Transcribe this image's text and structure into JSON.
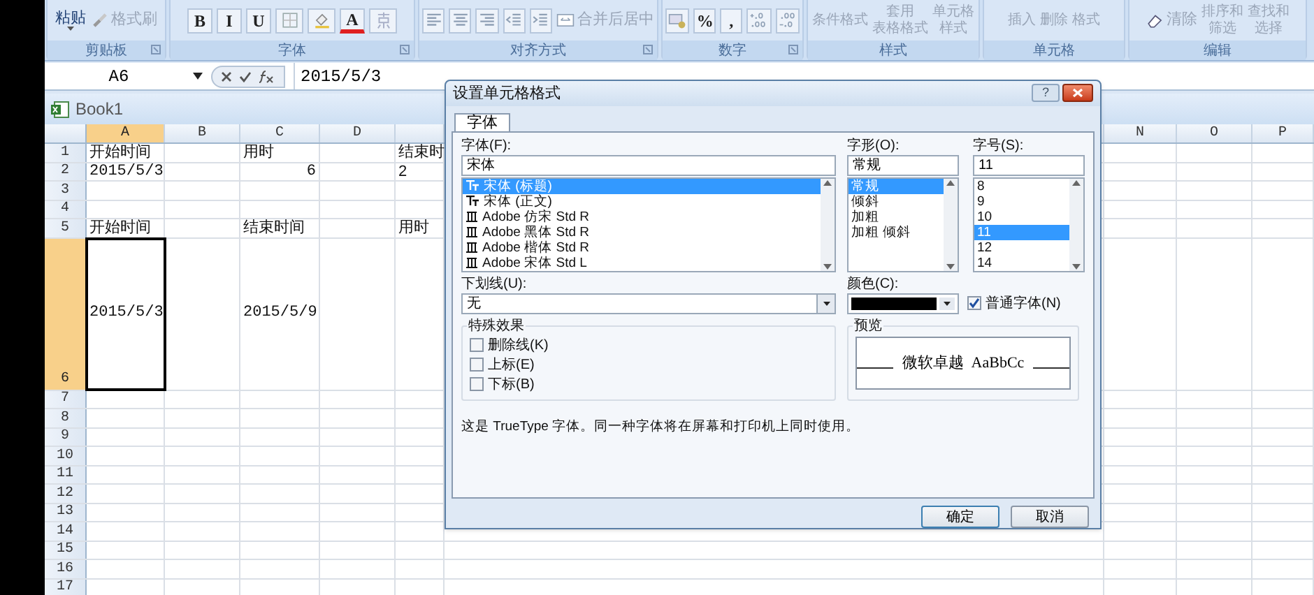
{
  "ribbon": {
    "groups": [
      {
        "label": "剪贴板",
        "items": [
          {
            "kind": "big",
            "text": "粘贴"
          },
          {
            "kind": "small",
            "text": "格式刷"
          }
        ]
      },
      {
        "label": "字体",
        "items": [
          {
            "kind": "letter",
            "text": "B"
          },
          {
            "kind": "letter",
            "text": "I"
          },
          {
            "kind": "letter",
            "text": "U"
          },
          {
            "kind": "icon"
          },
          {
            "kind": "icon"
          },
          {
            "kind": "letter",
            "text": "A"
          },
          {
            "kind": "icon"
          }
        ]
      },
      {
        "label": "对齐方式",
        "items": [
          {
            "kind": "icon"
          },
          {
            "kind": "icon"
          },
          {
            "kind": "icon"
          },
          {
            "kind": "icon"
          },
          {
            "kind": "icon"
          },
          {
            "kind": "small",
            "text": "合并后居中"
          }
        ]
      },
      {
        "label": "数字",
        "items": [
          {
            "kind": "icon"
          },
          {
            "kind": "letter",
            "text": "%"
          },
          {
            "kind": "letter",
            "text": ","
          },
          {
            "kind": "icon"
          },
          {
            "kind": "icon"
          }
        ]
      },
      {
        "label": "样式",
        "items": [
          {
            "kind": "stack",
            "text": "条件格式"
          },
          {
            "kind": "stack",
            "text": "套用",
            "text2": "表格格式"
          },
          {
            "kind": "stack",
            "text": "单元格",
            "text2": "样式"
          }
        ]
      },
      {
        "label": "单元格",
        "items": [
          {
            "kind": "stack",
            "text": "插入"
          },
          {
            "kind": "stack",
            "text": "删除"
          },
          {
            "kind": "stack",
            "text": "格式"
          }
        ]
      },
      {
        "label": "编辑",
        "items": [
          {
            "kind": "small",
            "text": "清除"
          },
          {
            "kind": "stack",
            "text": "排序和",
            "text2": "筛选"
          },
          {
            "kind": "stack",
            "text": "查找和",
            "text2": "选择"
          }
        ]
      }
    ]
  },
  "formula_bar": {
    "name_box": "A6",
    "value": "2015/5/3"
  },
  "workbook": {
    "title": "Book1"
  },
  "columns": [
    {
      "label": "A",
      "selected": true
    },
    {
      "label": "B",
      "selected": false
    },
    {
      "label": "C",
      "selected": false
    },
    {
      "label": "D",
      "selected": false
    },
    {
      "label": "N",
      "selected": false
    },
    {
      "label": "O",
      "selected": false
    },
    {
      "label": "P",
      "selected": false
    }
  ],
  "rows": [
    {
      "label": "1",
      "selected": false,
      "cells": [
        {
          "text": "开始时间",
          "kind": "text"
        },
        null,
        {
          "text": "用时",
          "kind": "text"
        },
        null,
        {
          "text": "结束时",
          "kind": "text"
        }
      ]
    },
    {
      "label": "2",
      "selected": false,
      "cells": [
        {
          "text": "2015/5/3",
          "kind": "number"
        },
        null,
        {
          "text": "6",
          "kind": "number"
        },
        null,
        {
          "text": "2",
          "kind": "text"
        }
      ]
    },
    {
      "label": "3",
      "selected": false,
      "cells": []
    },
    {
      "label": "4",
      "selected": false,
      "cells": []
    },
    {
      "label": "5",
      "selected": false,
      "cells": [
        {
          "text": "开始时间",
          "kind": "text"
        },
        null,
        {
          "text": "结束时间",
          "kind": "text"
        },
        null,
        {
          "text": "用时",
          "kind": "text"
        }
      ]
    },
    {
      "label": "6",
      "selected": true,
      "cells": [
        {
          "text": "2015/5/3",
          "kind": "number"
        },
        null,
        {
          "text": "2015/5/9",
          "kind": "number"
        }
      ]
    },
    {
      "label": "7",
      "selected": false,
      "cells": []
    },
    {
      "label": "8",
      "selected": false,
      "cells": []
    },
    {
      "label": "9",
      "selected": false,
      "cells": []
    },
    {
      "label": "10",
      "selected": false,
      "cells": []
    },
    {
      "label": "11",
      "selected": false,
      "cells": []
    },
    {
      "label": "12",
      "selected": false,
      "cells": []
    },
    {
      "label": "13",
      "selected": false,
      "cells": []
    },
    {
      "label": "14",
      "selected": false,
      "cells": []
    },
    {
      "label": "15",
      "selected": false,
      "cells": []
    },
    {
      "label": "16",
      "selected": false,
      "cells": []
    },
    {
      "label": "17",
      "selected": false,
      "cells": []
    }
  ],
  "dialog": {
    "title": "设置单元格格式",
    "help": "?",
    "tabs": [
      {
        "label": "字体",
        "selected": true
      }
    ],
    "font": {
      "label": "字体(F):",
      "value": "宋体",
      "options": [
        {
          "text": "宋体 (标题)",
          "kind": "truetype",
          "selected": true
        },
        {
          "text": "宋体 (正文)",
          "kind": "truetype",
          "selected": false
        },
        {
          "text": "Adobe 仿宋 Std R",
          "kind": "opentype",
          "selected": false
        },
        {
          "text": "Adobe 黑体 Std R",
          "kind": "opentype",
          "selected": false
        },
        {
          "text": "Adobe 楷体 Std R",
          "kind": "opentype",
          "selected": false
        },
        {
          "text": "Adobe 宋体 Std L",
          "kind": "opentype",
          "selected": false
        }
      ]
    },
    "style": {
      "label": "字形(O):",
      "value": "常规",
      "options": [
        {
          "text": "常规",
          "selected": true
        },
        {
          "text": "倾斜",
          "selected": false
        },
        {
          "text": "加粗",
          "selected": false
        },
        {
          "text": "加粗 倾斜",
          "selected": false
        }
      ]
    },
    "size": {
      "label": "字号(S):",
      "value": "11",
      "options": [
        {
          "text": "8",
          "selected": false
        },
        {
          "text": "9",
          "selected": false
        },
        {
          "text": "10",
          "selected": false
        },
        {
          "text": "11",
          "selected": true
        },
        {
          "text": "12",
          "selected": false
        },
        {
          "text": "14",
          "selected": false
        }
      ]
    },
    "underline": {
      "label": "下划线(U):",
      "value": "无"
    },
    "color": {
      "label": "颜色(C):",
      "color": "#000000"
    },
    "normal_font": {
      "label": "普通字体(N)",
      "checked": true
    },
    "effects": {
      "label": "特殊效果",
      "items": [
        {
          "label": "删除线(K)",
          "checked": false
        },
        {
          "label": "上标(E)",
          "checked": false
        },
        {
          "label": "下标(B)",
          "checked": false
        }
      ]
    },
    "preview": {
      "label": "预览",
      "text": "微软卓越  AaBbCc"
    },
    "note": "这是 TrueType 字体。同一种字体将在屏幕和打印机上同时使用。",
    "buttons": [
      {
        "label": "确定"
      },
      {
        "label": "取消"
      }
    ]
  }
}
